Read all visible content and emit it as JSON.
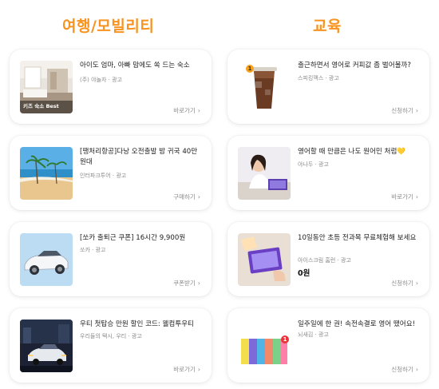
{
  "columns": {
    "left_title": "여행/모빌리티",
    "right_title": "교육"
  },
  "left_cards": [
    {
      "title": "아이도 엄마, 아빠 맘에도 쏙 드는 숙소",
      "sub": "(주) 야놀자 · 광고",
      "cta": "바로가기",
      "thumb_text": "키즈 숙소 Best"
    },
    {
      "title": "[땡처리항공]다낭 오전출발 밤 귀국 40만원대",
      "sub": "인터파크투어 · 광고",
      "cta": "구매하기"
    },
    {
      "title": "[쏘카 출퇴근 쿠폰] 16시간 9,900원",
      "sub": "쏘카 · 광고",
      "cta": "쿠폰받기"
    },
    {
      "title": "우티 첫탑승 만원 할인 코드: 웰컴투우티",
      "sub": "우리들의 택시, 우티 · 광고",
      "cta": "바로가기"
    }
  ],
  "right_cards": [
    {
      "title": "출근하면서 영어로 커피값 좀 벌어볼까?",
      "sub": "스피킹맥스 · 광고",
      "cta": "신청하기",
      "badge": "1"
    },
    {
      "title": "영어할 때 만큼은 나도 원어민 처럼💛",
      "sub": "야나두 · 광고",
      "cta": "바로가기"
    },
    {
      "title": "10일동안 초등 전과목 무료체험해 보세요",
      "sub": "아이스크림 홈런 · 광고",
      "price": "0원",
      "cta": "신청하기"
    },
    {
      "title": "일주일에 한 권! 속전속결로 영어 뗐어요!",
      "sub": "뇌새김 · 광고",
      "cta": "신청하기",
      "badge": "1"
    }
  ],
  "icons": {
    "cta_chevron": "chevron-right-icon"
  },
  "colors": {
    "accent": "#f7931e",
    "sub_text": "#8b8b8b"
  }
}
